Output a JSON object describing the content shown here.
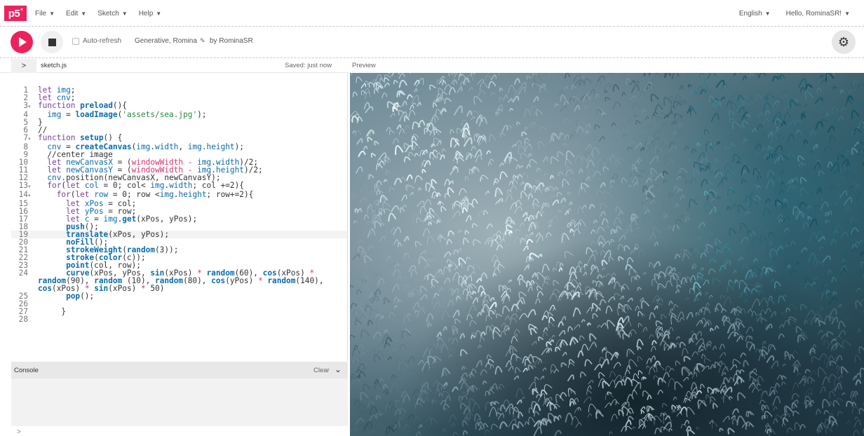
{
  "nav": {
    "logo": "p5",
    "menus": [
      {
        "label": "File"
      },
      {
        "label": "Edit"
      },
      {
        "label": "Sketch"
      },
      {
        "label": "Help"
      }
    ],
    "language": "English",
    "user_greeting": "Hello, RominaSR!"
  },
  "toolbar": {
    "auto_refresh_label": "Auto-refresh",
    "sketch_name": "Generative, Romina",
    "by_line": "by RominaSR",
    "icons": {
      "play": "play-icon",
      "stop": "stop-icon",
      "settings": "gear-icon",
      "edit": "pencil-icon"
    }
  },
  "editor": {
    "file_name": "sketch.js",
    "saved_status": "Saved: just now",
    "active_line": 19
  },
  "preview": {
    "label": "Preview"
  },
  "console": {
    "title": "Console",
    "clear_label": "Clear",
    "prompt": ">"
  },
  "colors": {
    "brand": "#ed225d",
    "stop_bg": "#f0f0f0",
    "console_header": "#e8e8e8",
    "console_body": "#f2f2f2"
  },
  "code": [
    {
      "n": "1",
      "fold": "",
      "html": "<span class=\"kw\">let</span> <span class=\"var\">img</span>;"
    },
    {
      "n": "2",
      "fold": "",
      "html": "<span class=\"kw\">let</span> <span class=\"var\">cnv</span>;"
    },
    {
      "n": "3",
      "fold": "▼",
      "html": "<span class=\"kw\">function</span> <span class=\"fn\">preload</span>(){"
    },
    {
      "n": "4",
      "fold": "",
      "html": "  <span class=\"var\">img</span> = <span class=\"fn\">loadImage</span>(<span class=\"str\">'assets/sea.jpg'</span>);"
    },
    {
      "n": "5",
      "fold": "",
      "html": "}"
    },
    {
      "n": "6",
      "fold": "",
      "html": "//"
    },
    {
      "n": "7",
      "fold": "▼",
      "html": "<span class=\"kw\">function</span> <span class=\"fn\">setup</span>() {"
    },
    {
      "n": "8",
      "fold": "",
      "html": "  <span class=\"var\">cnv</span> = <span class=\"fn\">createCanvas</span>(<span class=\"var\">img</span>.<span class=\"var\">width</span>, <span class=\"var\">img</span>.<span class=\"var\">height</span>);"
    },
    {
      "n": "9",
      "fold": "",
      "html": "  //center image"
    },
    {
      "n": "10",
      "fold": "",
      "html": "  <span class=\"kw\">let</span> <span class=\"var\">newCanvasX</span> = (<span class=\"glob\">windowWidth</span> <span class=\"op\">-</span> <span class=\"var\">img</span>.<span class=\"var\">width</span>)/2;"
    },
    {
      "n": "11",
      "fold": "",
      "html": "  <span class=\"kw\">let</span> <span class=\"var\">newCanvasY</span> = (<span class=\"glob\">windowWidth</span> <span class=\"op\">-</span> <span class=\"var\">img</span>.<span class=\"var\">height</span>)/2;"
    },
    {
      "n": "12",
      "fold": "",
      "html": "  <span class=\"var\">cnv</span>.position(newCanvasX, newCanvasY);"
    },
    {
      "n": "13",
      "fold": "▼",
      "html": "  <span class=\"kw\">for</span>(<span class=\"kw\">let</span> <span class=\"var\">col</span> = 0; col&lt; <span class=\"var\">img</span>.<span class=\"var\">width</span>; col +=2){"
    },
    {
      "n": "14",
      "fold": "▼",
      "html": "    <span class=\"kw\">for</span>(<span class=\"kw\">let</span> <span class=\"var\">row</span> = 0; row &lt;<span class=\"var\">img</span>.<span class=\"var\">height</span>; row+=2){"
    },
    {
      "n": "15",
      "fold": "",
      "html": "      <span class=\"kw\">let</span> <span class=\"var\">xPos</span> = col;"
    },
    {
      "n": "16",
      "fold": "",
      "html": "      <span class=\"kw\">let</span> <span class=\"var\">yPos</span> = row;"
    },
    {
      "n": "17",
      "fold": "",
      "html": "      <span class=\"kw\">let</span> <span class=\"var\">c</span> = <span class=\"var\">img</span>.<span class=\"fn\">get</span>(xPos, yPos);"
    },
    {
      "n": "18",
      "fold": "",
      "html": "      <span class=\"fn\">push</span>();"
    },
    {
      "n": "19",
      "fold": "",
      "html": "      <span class=\"fn\">translate</span>(xPos, yPos);"
    },
    {
      "n": "20",
      "fold": "",
      "html": "      <span class=\"fn\">noFill</span>();"
    },
    {
      "n": "21",
      "fold": "",
      "html": "      <span class=\"fn\">strokeWeight</span>(<span class=\"fn\">random</span>(3));"
    },
    {
      "n": "22",
      "fold": "",
      "html": "      <span class=\"fn\">stroke</span>(<span class=\"fn\">color</span>(c));"
    },
    {
      "n": "23",
      "fold": "",
      "html": "      <span class=\"fn\">point</span>(col, row);"
    },
    {
      "n": "24",
      "fold": "",
      "html": "      <span class=\"fn\">curve</span>(xPos, yPos, <span class=\"fn\">sin</span>(xPos) <span class=\"op\">*</span> <span class=\"fn\">random</span>(60), <span class=\"fn\">cos</span>(xPos) <span class=\"op\">*</span>"
    },
    {
      "n": "",
      "fold": "",
      "html": "<span class=\"fn\">random</span>(90), <span class=\"fn\">random</span> (10), <span class=\"fn\">random</span>(80), <span class=\"fn\">cos</span>(yPos) <span class=\"op\">*</span> <span class=\"fn\">random</span>(140),",
      "wrap": true
    },
    {
      "n": "",
      "fold": "",
      "html": "<span class=\"fn\">cos</span>(xPos) <span class=\"op\">*</span> <span class=\"fn\">sin</span>(xPos) <span class=\"op\">*</span> 50)",
      "wrap": true
    },
    {
      "n": "25",
      "fold": "",
      "html": "      <span class=\"fn\">pop</span>();"
    },
    {
      "n": "26",
      "fold": "",
      "html": ""
    },
    {
      "n": "27",
      "fold": "",
      "html": "     }"
    },
    {
      "n": "28",
      "fold": "",
      "html": ""
    }
  ]
}
